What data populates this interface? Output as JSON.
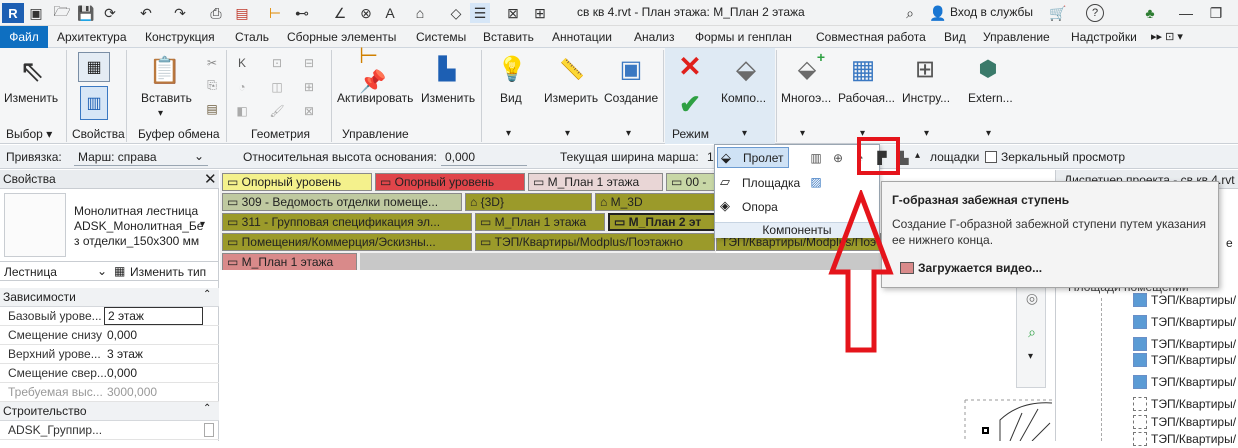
{
  "title": {
    "text": "св кв 4.rvt - План этажа: М_План 2 этажа",
    "login": "Вход в службы",
    "help": "?"
  },
  "menu": {
    "file": "Файл",
    "tabs": [
      "Архитектура",
      "Конструкция",
      "Сталь",
      "Сборные элементы",
      "Системы",
      "Вставить",
      "Аннотации",
      "Анализ",
      "Формы и генплан",
      "Совместная работа",
      "Вид",
      "Управление",
      "Надстройки"
    ]
  },
  "ribbon": {
    "buttons": {
      "modify": "Изменить",
      "insert": "Вставить",
      "activate": "Активировать",
      "modify2": "Изменить",
      "view": "Вид",
      "measure": "Измерить",
      "create": "Создание",
      "component": "Компо...",
      "multistory": "Многоэ...",
      "workplane": "Рабочая...",
      "tools": "Инстру...",
      "external": "Extern..."
    },
    "panels": {
      "select": "Выбор",
      "properties": "Свойства",
      "clipboard": "Буфер обмена",
      "geometry": "Геометрия",
      "control": "Управление",
      "mode": "Режим"
    }
  },
  "options": {
    "anchor_label": "Привязка:",
    "anchor_value": "Марш: справа",
    "base_offset_label": "Относительная высота основания:",
    "base_offset_value": "0,000",
    "width_label": "Текущая ширина марша:",
    "width_value": "1",
    "landings_partial": "лощадки",
    "mirror_label": "Зеркальный просмотр"
  },
  "properties": {
    "header": "Свойства",
    "type_name_1": "Монолитная лестница",
    "type_name_2": "ADSK_Монолитная_Бе",
    "type_name_3": "з отделки_150x300 мм",
    "category": "Лестница",
    "edit_type": "Изменить тип",
    "group_constraints": "Зависимости",
    "rows": [
      {
        "label": "Базовый урове...",
        "value": "2 этаж"
      },
      {
        "label": "Смещение снизу",
        "value": "0,000"
      },
      {
        "label": "Верхний урове...",
        "value": "3 этаж"
      },
      {
        "label": "Смещение свер...",
        "value": "0,000"
      },
      {
        "label": "Требуемая выс...",
        "value": "3000,000"
      }
    ],
    "group_construction": "Строительство",
    "construction_row": "ADSK_Группир..."
  },
  "view_tabs": {
    "row1": [
      "Опорный уровень",
      "Опорный уровень",
      "М_План 1 этажа",
      "00 -"
    ],
    "row2": [
      "309 - Ведомость отделки помеще...",
      "{3D}",
      "М_3D"
    ],
    "row3": [
      "311 - Групповая спецификация эл...",
      "М_План 1 этажа",
      "М_План 2 эт"
    ],
    "row4": [
      "Помещения/Коммерция/Эскизны...",
      "ТЭП/Квартиры/Modplus/Поэтажно",
      "ТЭП/Квартиры/Modplus/Поэ"
    ],
    "row5": [
      "М_План 1 этажа"
    ]
  },
  "dropdown": {
    "items": [
      "Пролет",
      "Площадка",
      "Опора"
    ],
    "footer": "Компоненты"
  },
  "tooltip": {
    "title": "Г-образная забежная ступень",
    "body_1": "Создание Г-образной забежной ступени путем указания",
    "body_2": "ее нижнего конца.",
    "video": "Загружается видео..."
  },
  "project_browser": {
    "header": "Диспетчер проекта - св кв 4.rvt",
    "section": "Площади помещений",
    "items": [
      "ТЭП/Квартиры/",
      "ТЭП/Квартиры/",
      "ТЭП/Квартиры/",
      "ТЭП/Квартиры/",
      "ТЭП/Квартиры/",
      "ТЭП/Квартиры/",
      "ТЭП/Квартиры/",
      "ТЭП/Квартиры/"
    ]
  },
  "colors": {
    "file_tab": "#0e6fc1",
    "highlight_red": "#e5141b",
    "check_green": "#2ea043",
    "cancel_red": "#e0201b"
  }
}
